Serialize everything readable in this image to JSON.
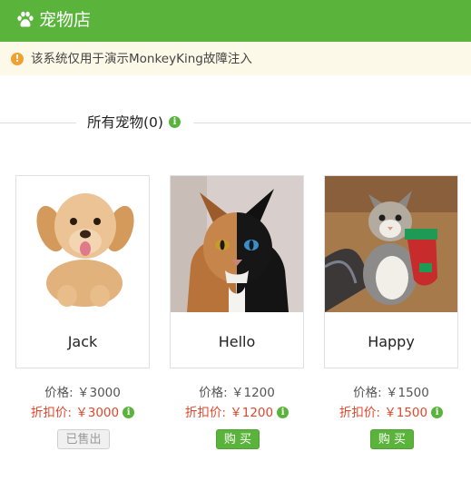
{
  "app": {
    "title": "宠物店",
    "logo_icon": "paw-icon"
  },
  "notice": {
    "icon": "exclamation-icon",
    "text": "该系统仅用于演示MonkeyKing故障注入"
  },
  "section": {
    "title": "所有宠物(0)",
    "info_icon": "info-icon"
  },
  "colors": {
    "brand_green": "#5ab43c",
    "discount_red": "#e0462c",
    "notice_bg": "#fcf9e8"
  },
  "pets": [
    {
      "name": "Jack",
      "price": "价格: ￥3000",
      "discount_price": "折扣价: ￥3000",
      "action": "已售出",
      "sold": true
    },
    {
      "name": "Hello",
      "price": "价格: ￥1200",
      "discount_price": "折扣价: ￥1200",
      "action": "购 买",
      "sold": false
    },
    {
      "name": "Happy",
      "price": "价格: ￥1500",
      "discount_price": "折扣价: ￥1500",
      "action": "购 买",
      "sold": false
    }
  ]
}
